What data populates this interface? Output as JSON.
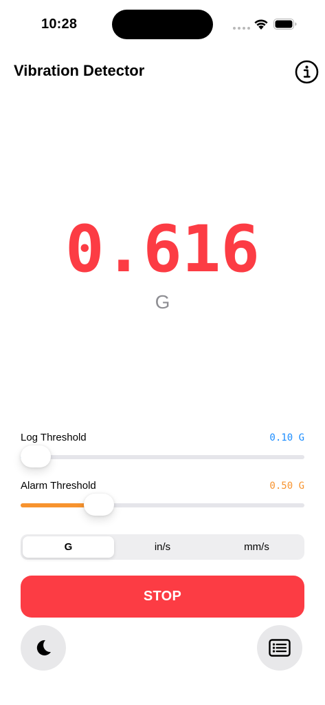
{
  "status_bar": {
    "time": "10:28"
  },
  "nav": {
    "title": "Vibration Detector",
    "info_icon": "info-circle-icon"
  },
  "reading": {
    "value": "0.616",
    "unit": "G",
    "color": "#fc3c44"
  },
  "log_threshold": {
    "label": "Log Threshold",
    "value_text": "0.10 G",
    "color": "#1a8cff",
    "level": 0.0
  },
  "alarm_threshold": {
    "label": "Alarm Threshold",
    "value_text": "0.50 G",
    "color": "#f7932e",
    "level": 0.25
  },
  "units": {
    "options": [
      "G",
      "in/s",
      "mm/s"
    ],
    "selected": "G"
  },
  "stop_button": {
    "label": "STOP",
    "color": "#fc3c44"
  },
  "bottom": {
    "left_icon": "moon-icon",
    "right_icon": "log-list-icon"
  }
}
